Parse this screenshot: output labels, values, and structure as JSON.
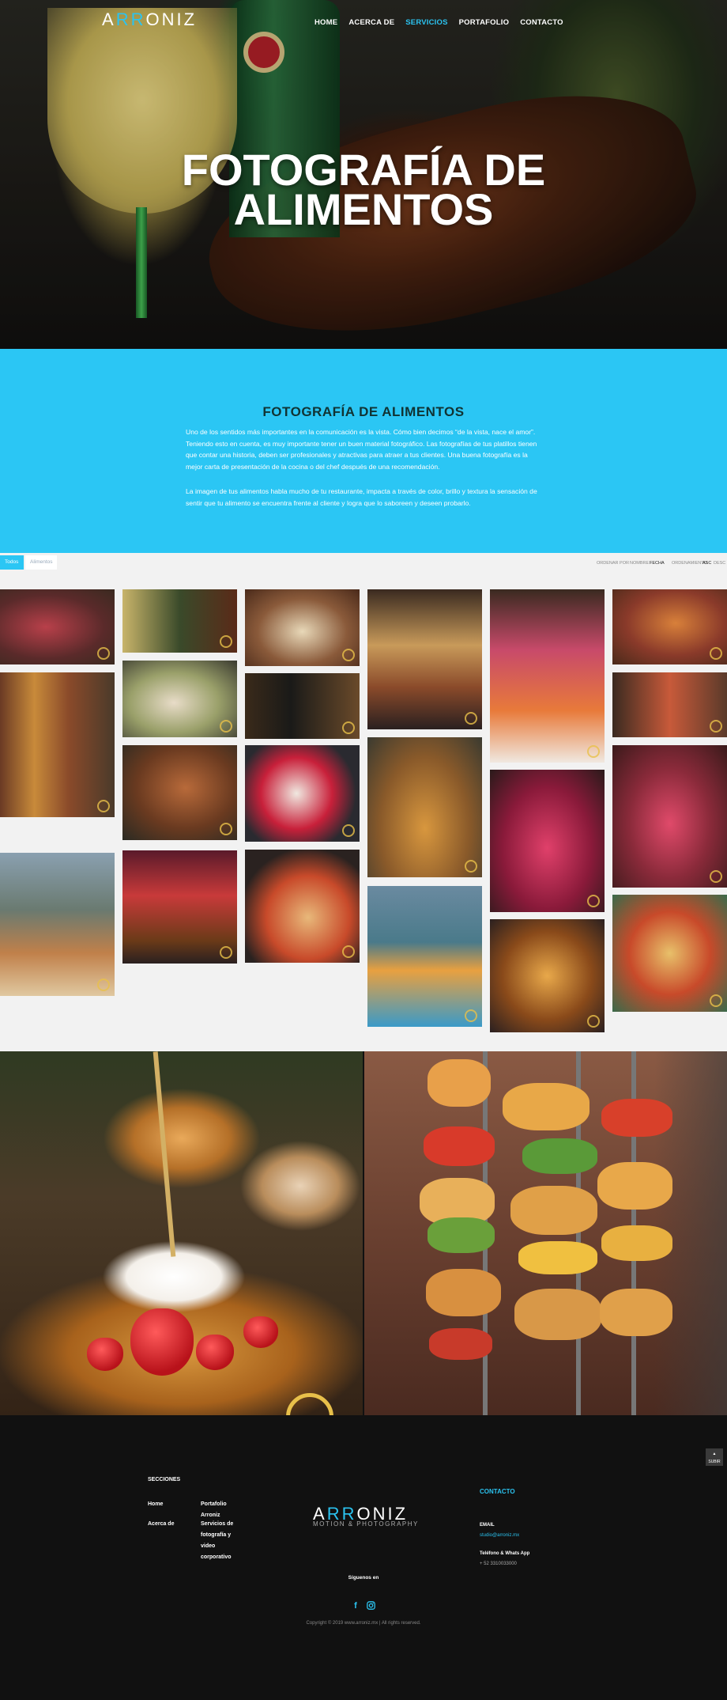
{
  "header": {
    "logo_prefix": "A",
    "logo_rr": "RR",
    "logo_suffix": "ONIZ",
    "nav": [
      "HOME",
      "ACERCA DE",
      "SERVICIOS",
      "PORTAFOLIO",
      "CONTACTO"
    ],
    "active_nav": "SERVICIOS",
    "hero_title_line1": "FOTOGRAFÍA DE",
    "hero_title_line2": "ALIMENTOS"
  },
  "about": {
    "title": "FOTOGRAFÍA DE ALIMENTOS",
    "paragraph1": "Uno de los sentidos más importantes en la comunicación es la vista. Cómo bien decimos “de la vista, nace el amor”. Teniendo esto en cuenta, es muy importante tener un buen material fotográfico. Las fotografías de tus platillos tienen que contar una historia, deben ser profesionales y atractivas para atraer a tus clientes. Una buena fotografía es la mejor carta de presentación de la cocina o del chef después de una recomendación.",
    "paragraph2": "La imagen de tus alimentos habla mucho de tu restaurante, impacta a través de color, brillo y textura la sensación de sentir que tu alimento se encuentra frente al cliente y logra que lo saboreen y deseen probarlo."
  },
  "filters": {
    "tabs": [
      "Todos",
      "Alimentos"
    ],
    "sort_by_label": "ORDENAR POR",
    "sort_options": [
      "NOMBRE",
      "FECHA"
    ],
    "order_label": "ORDENAMIENTO",
    "order_options": [
      "ASC",
      "DESC"
    ]
  },
  "footer": {
    "sections_title": "SECCIONES",
    "links_col1": [
      "Home",
      "Acerca de"
    ],
    "links_col2": [
      "Portafolio Arroniz",
      "Servicios de fotografía y video corporativo"
    ],
    "logo_prefix": "A",
    "logo_rr": "RR",
    "logo_suffix": "ONIZ",
    "logo_sub": "MOTION & PHOTOGRAPHY",
    "contact_title": "CONTACTO",
    "email_label": "EMAIL",
    "email_value": "studio@arroniz.mx",
    "phone_label": "Teléfono & Whats App",
    "phone_value": "+ 52 3310033000",
    "follow_label": "Síguenos en",
    "copyright": "Copyright © 2019 www.arroniz.mx  |  All rights reserved.",
    "to_top_label": "SUBIR"
  },
  "icons": [
    "facebook-icon",
    "instagram-icon",
    "arrow-up-icon"
  ],
  "colors": {
    "accent": "#2bc6f4",
    "footer_bg": "#111111",
    "gallery_bg": "#f2f2f2"
  }
}
